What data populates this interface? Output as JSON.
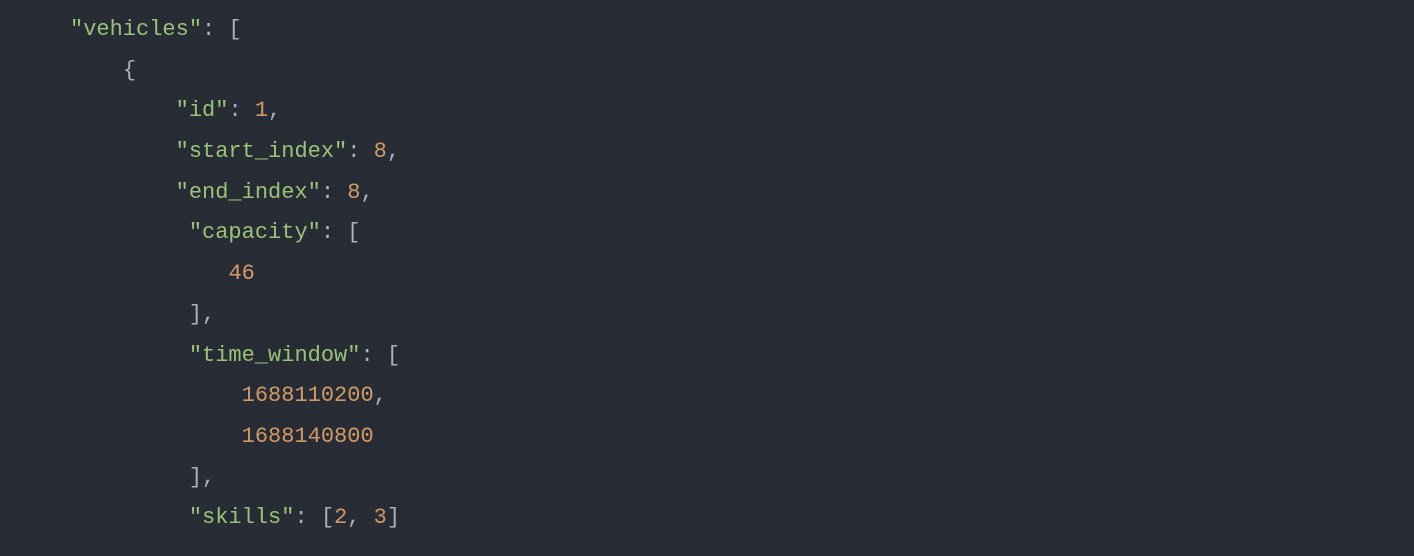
{
  "code": {
    "lines": [
      {
        "indent": 0,
        "tokens": [
          {
            "type": "key",
            "text": "\"vehicles\""
          },
          {
            "type": "punct",
            "text": ": ["
          }
        ]
      },
      {
        "indent": 1,
        "tokens": [
          {
            "type": "punct",
            "text": "{"
          }
        ]
      },
      {
        "indent": 2,
        "tokens": [
          {
            "type": "key",
            "text": "\"id\""
          },
          {
            "type": "punct",
            "text": ": "
          },
          {
            "type": "number",
            "text": "1"
          },
          {
            "type": "punct",
            "text": ","
          }
        ]
      },
      {
        "indent": 2,
        "tokens": [
          {
            "type": "key",
            "text": "\"start_index\""
          },
          {
            "type": "punct",
            "text": ": "
          },
          {
            "type": "number",
            "text": "8"
          },
          {
            "type": "punct",
            "text": ","
          }
        ]
      },
      {
        "indent": 2,
        "tokens": [
          {
            "type": "key",
            "text": "\"end_index\""
          },
          {
            "type": "punct",
            "text": ": "
          },
          {
            "type": "number",
            "text": "8"
          },
          {
            "type": "punct",
            "text": ","
          }
        ]
      },
      {
        "indent": 2,
        "extraSpace": true,
        "tokens": [
          {
            "type": "key",
            "text": "\"capacity\""
          },
          {
            "type": "punct",
            "text": ": ["
          }
        ]
      },
      {
        "indent": 3,
        "tokens": [
          {
            "type": "number",
            "text": "46"
          }
        ]
      },
      {
        "indent": 2,
        "extraSpace": true,
        "tokens": [
          {
            "type": "punct",
            "text": "],"
          }
        ]
      },
      {
        "indent": 2,
        "extraSpace": true,
        "tokens": [
          {
            "type": "key",
            "text": "\"time_window\""
          },
          {
            "type": "punct",
            "text": ": ["
          }
        ]
      },
      {
        "indent": 3,
        "extraSpace": true,
        "tokens": [
          {
            "type": "number",
            "text": "1688110200"
          },
          {
            "type": "punct",
            "text": ","
          }
        ]
      },
      {
        "indent": 3,
        "extraSpace": true,
        "tokens": [
          {
            "type": "number",
            "text": "1688140800"
          }
        ]
      },
      {
        "indent": 2,
        "extraSpace": true,
        "tokens": [
          {
            "type": "punct",
            "text": "],"
          }
        ]
      },
      {
        "indent": 2,
        "extraSpace": true,
        "tokens": [
          {
            "type": "key",
            "text": "\"skills\""
          },
          {
            "type": "punct",
            "text": ": ["
          },
          {
            "type": "number",
            "text": "2"
          },
          {
            "type": "punct",
            "text": ", "
          },
          {
            "type": "number",
            "text": "3"
          },
          {
            "type": "punct",
            "text": "]"
          }
        ]
      }
    ]
  }
}
